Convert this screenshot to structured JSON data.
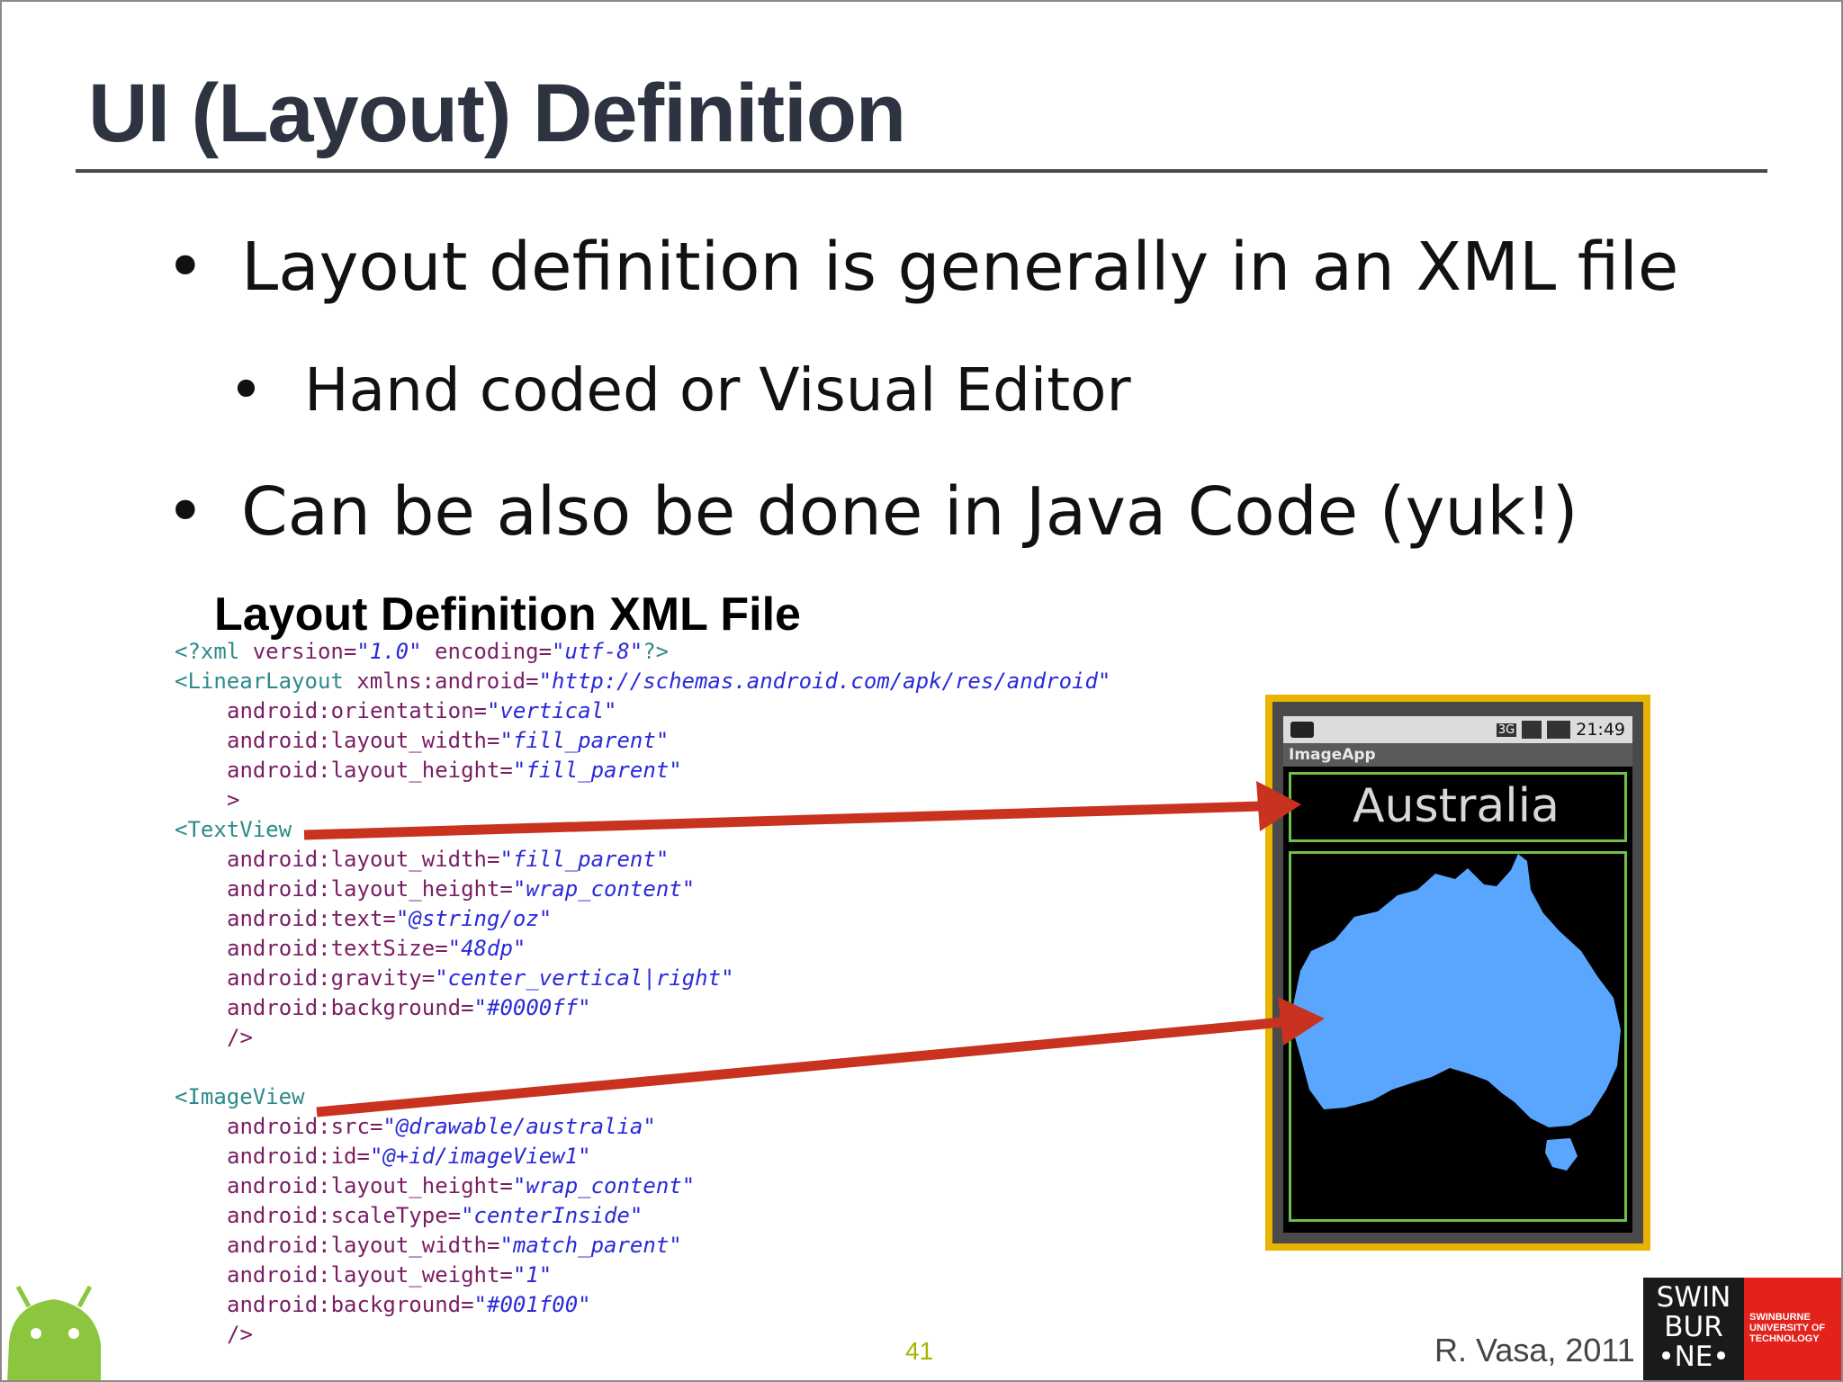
{
  "slide": {
    "title": "UI (Layout) Definition",
    "bullets": [
      {
        "marker": "•",
        "text": "Layout definition is generally in an XML file"
      },
      {
        "marker": "•",
        "text": "Hand coded or Visual Editor"
      },
      {
        "marker": "•",
        "text": "Can be also be done in Java Code (yuk!)"
      }
    ],
    "code_heading": "Layout Definition XML File"
  },
  "code": {
    "lines": [
      {
        "tag": "<?xml",
        "attr": " version=",
        "val": "\"1.0\"",
        "attr2": " encoding=",
        "val2": "\"utf-8\"",
        "close": "?>"
      },
      {
        "tag": "<LinearLayout",
        "attr": " xmlns:android=",
        "val": "\"http://schemas.android.com/apk/res/android\""
      },
      {
        "attr": "android:orientation=",
        "val": "\"vertical\""
      },
      {
        "attr": "android:layout_width=",
        "val": "\"fill_parent\""
      },
      {
        "attr": "android:layout_height=",
        "val": "\"fill_parent\""
      },
      {
        "attr": ">"
      },
      {
        "tag": "<TextView"
      },
      {
        "attr": "android:layout_width=",
        "val": "\"fill_parent\""
      },
      {
        "attr": "android:layout_height=",
        "val": "\"wrap_content\""
      },
      {
        "attr": "android:text=",
        "val": "\"@string/oz\""
      },
      {
        "attr": "android:textSize=",
        "val": "\"48dp\""
      },
      {
        "attr": "android:gravity=",
        "val": "\"center_vertical|right\""
      },
      {
        "attr": "android:background=",
        "val": "\"#0000ff\""
      },
      {
        "attr": "/>"
      },
      {
        "blank": true
      },
      {
        "tag": "<ImageView"
      },
      {
        "attr": "android:src=",
        "val": "\"@drawable/australia\""
      },
      {
        "attr": "android:id=",
        "val": "\"@+id/imageView1\""
      },
      {
        "attr": "android:layout_height=",
        "val": "\"wrap_content\""
      },
      {
        "attr": "android:scaleType=",
        "val": "\"centerInside\""
      },
      {
        "attr": "android:layout_width=",
        "val": "\"match_parent\""
      },
      {
        "attr": "android:layout_weight=",
        "val": "\"1\""
      },
      {
        "attr": "android:background=",
        "val": "\"#001f00\""
      },
      {
        "attr": "/>"
      }
    ]
  },
  "phone": {
    "status_time": "21:49",
    "status_network": "3G",
    "app_title": "ImageApp",
    "text_view": "Australia"
  },
  "footer": {
    "page_number": "41",
    "author": "R. Vasa, 2011",
    "logo_left_lines": [
      "SWIN",
      "BUR",
      "•NE•"
    ],
    "logo_right_lines": [
      "SWINBURNE",
      "UNIVERSITY OF",
      "TECHNOLOGY"
    ]
  },
  "colors": {
    "title": "#2d3340",
    "xml_tag": "#2e8a8a",
    "xml_attr": "#7a1e64",
    "xml_value": "#2a2ad8",
    "arrow": "#c8321e",
    "phone_frame": "#e8b400",
    "view_border": "#6fbf4a",
    "map": "#5aa6ff",
    "logo_red": "#e3231b"
  }
}
